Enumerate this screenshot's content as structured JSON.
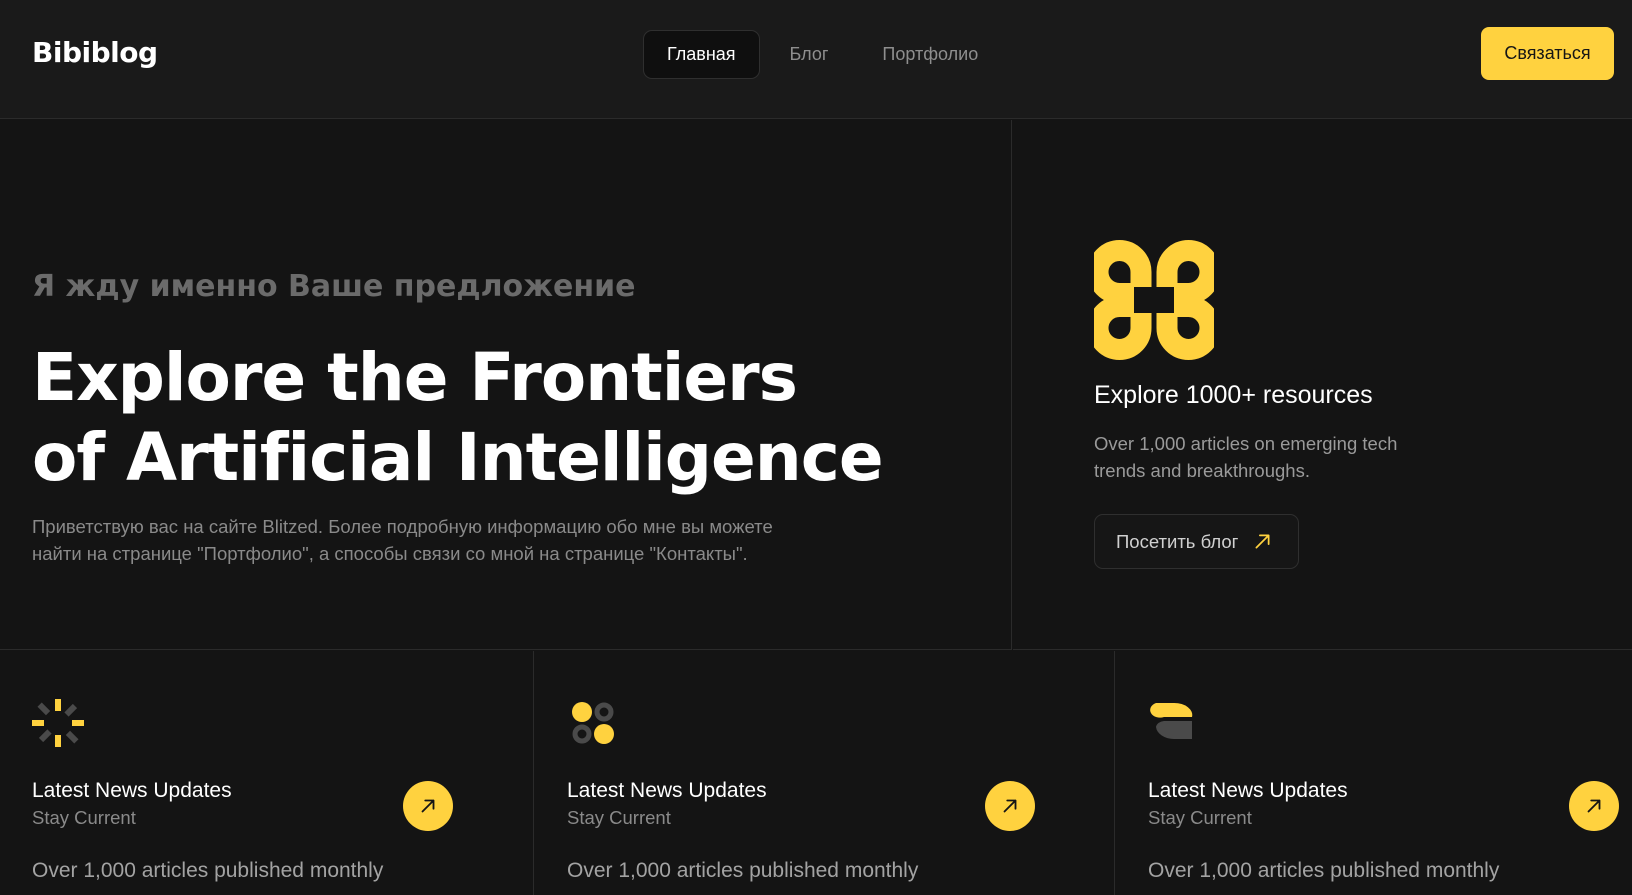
{
  "header": {
    "logo": "Bibiblog",
    "nav": [
      {
        "label": "Главная",
        "active": true
      },
      {
        "label": "Блог",
        "active": false
      },
      {
        "label": "Портфолио",
        "active": false
      }
    ],
    "contact_label": "Связаться"
  },
  "hero": {
    "eyebrow": "Я жду именно Ваше предложение",
    "title_line1": "Explore the Frontiers",
    "title_line2": "of Artificial Intelligence",
    "description": "Приветствую вас на сайте Blitzed. Более подробную информацию обо мне вы можете найти на странице \"Портфолио\", а способы связи со мной на странице \"Контакты\"."
  },
  "resources": {
    "icon": "linked-rings-icon",
    "title": "Explore 1000+ resources",
    "description": "Over 1,000 articles on emerging tech trends and breakthroughs.",
    "button_label": "Посетить блог",
    "button_icon": "arrow-up-right-icon"
  },
  "cards": [
    {
      "icon": "sparkle-icon",
      "title": "Latest News Updates",
      "subtitle": "Stay Current",
      "stat": "Over 1,000 articles published monthly"
    },
    {
      "icon": "dots-grid-icon",
      "title": "Latest News Updates",
      "subtitle": "Stay Current",
      "stat": "Over 1,000 articles published monthly"
    },
    {
      "icon": "half-circles-icon",
      "title": "Latest News Updates",
      "subtitle": "Stay Current",
      "stat": "Over 1,000 articles published monthly"
    }
  ],
  "colors": {
    "accent": "#ffd23f",
    "background": "#141414",
    "header_background": "#1a1a1a",
    "border": "#2b2b2b",
    "muted_text": "#8a8a8a"
  }
}
